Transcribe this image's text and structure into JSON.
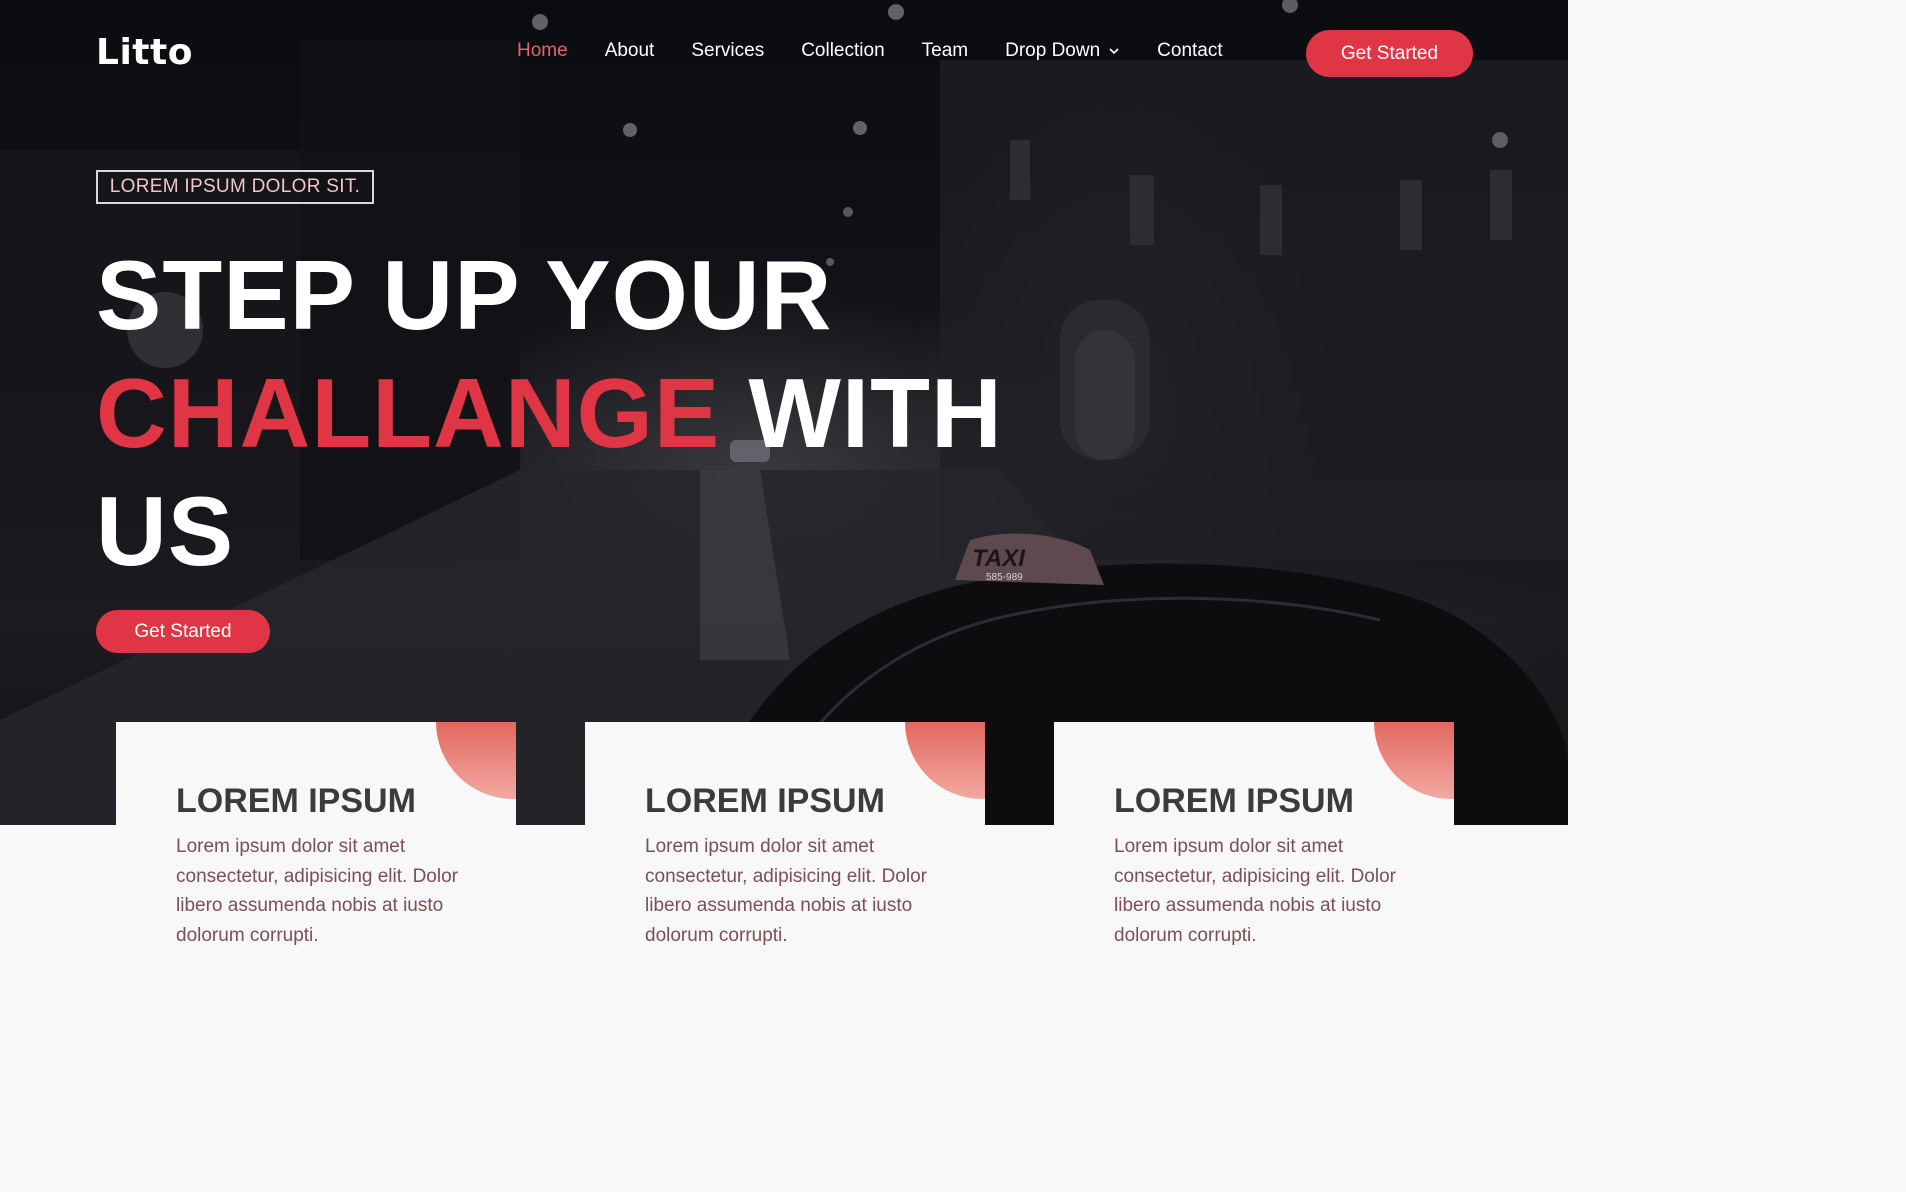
{
  "brand": {
    "logo": "Litto"
  },
  "nav": {
    "items": [
      {
        "label": "Home",
        "active": true
      },
      {
        "label": "About"
      },
      {
        "label": "Services"
      },
      {
        "label": "Collection"
      },
      {
        "label": "Team"
      },
      {
        "label": "Drop Down",
        "icon": "chevron-down-icon"
      },
      {
        "label": "Contact"
      }
    ],
    "cta_label": "Get Started"
  },
  "hero": {
    "tagline": "LOREM IPSUM DOLOR SIT.",
    "headline_line1": "STEP UP YOUR",
    "headline_accent": "CHALLANGE",
    "headline_line2_rest": " WITH",
    "headline_line3": "US",
    "cta_label": "Get Started",
    "taxi_sign_text": "TAXI",
    "taxi_sign_number": "585-989"
  },
  "cards": [
    {
      "title": "LOREM IPSUM",
      "text": "Lorem ipsum dolor sit amet consectetur, adipisicing elit. Dolor libero assumenda nobis at iusto dolorum corrupti."
    },
    {
      "title": "LOREM IPSUM",
      "text": "Lorem ipsum dolor sit amet consectetur, adipisicing elit. Dolor libero assumenda nobis at iusto dolorum corrupti."
    },
    {
      "title": "LOREM IPSUM",
      "text": "Lorem ipsum dolor sit amet consectetur, adipisicing elit. Dolor libero assumenda nobis at iusto dolorum corrupti."
    }
  ],
  "colors": {
    "accent": "#df3545",
    "active_nav": "#e0646e",
    "card_deco_top": "#e2685f",
    "card_deco_bottom": "#f2a9a2",
    "card_title": "#3d3a3a",
    "card_text": "#7a4f55"
  }
}
